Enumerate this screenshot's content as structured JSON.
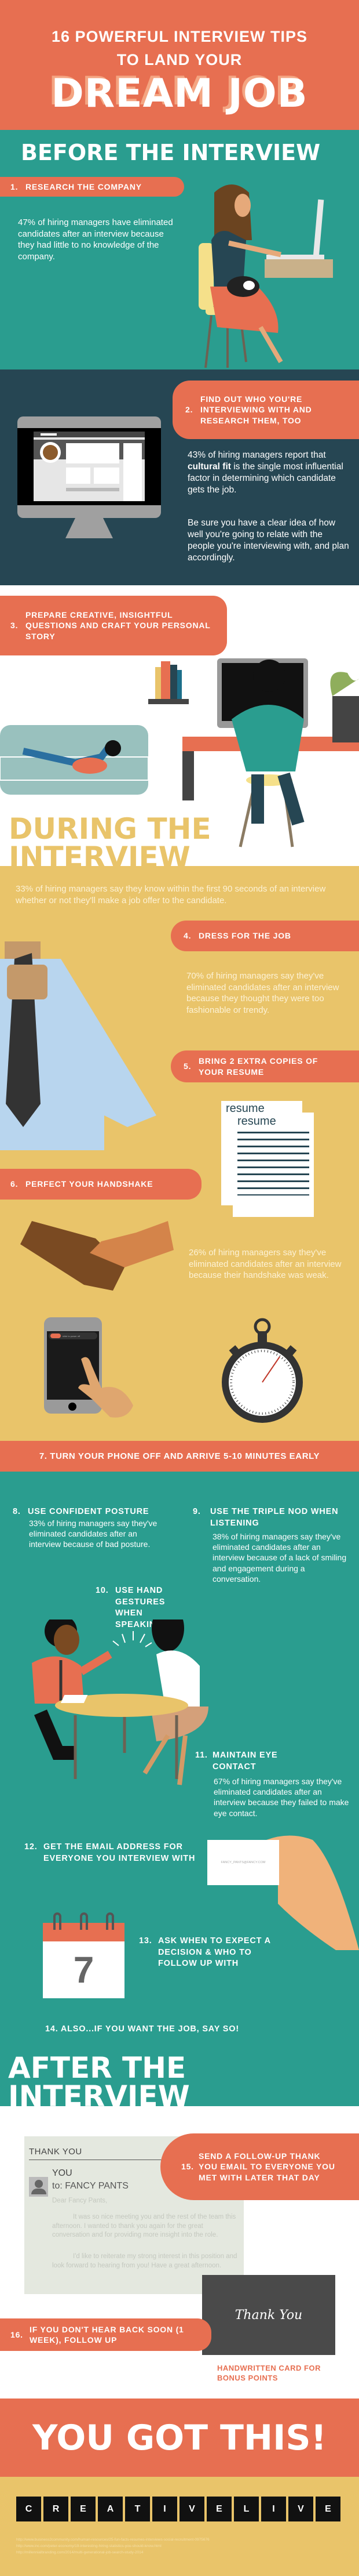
{
  "colors": {
    "coral": "#e76f51",
    "teal": "#2a9d8f",
    "navy": "#264653",
    "gold": "#e9c46a"
  },
  "header": {
    "line1": "16 POWERFUL INTERVIEW TIPS",
    "line2": "TO LAND YOUR",
    "big": "DREAM JOB"
  },
  "before": {
    "title": "BEFORE THE INTERVIEW",
    "tip1": {
      "num": "1.",
      "label": "RESEARCH THE COMPANY",
      "text": "47% of hiring managers have eliminated candidates after an interview because they had little to no knowledge of the company."
    },
    "tip2": {
      "num": "2.",
      "label": "FIND OUT WHO YOU'RE INTERVIEWING WITH AND RESEARCH THEM, TOO",
      "text_prefix": "43% of hiring managers report that ",
      "text_bold": "cultural fit",
      "text_suffix": " is the single most influential factor in determining which candidate gets the job.",
      "text2": "Be sure you have a clear idea of how well you're going to relate with the people you're interviewing with, and plan accordingly."
    },
    "tip3": {
      "num": "3.",
      "label": "PREPARE CREATIVE, INSIGHTFUL QUESTIONS AND CRAFT YOUR PERSONAL STORY"
    }
  },
  "during": {
    "title1": "DURING THE",
    "title2": "INTERVIEW",
    "intro": "33% of hiring managers say they know within the first 90 seconds of an interview whether or not they'll make a job offer to the candidate.",
    "tip4": {
      "num": "4.",
      "label": "DRESS FOR THE JOB",
      "text": "70% of hiring managers say they've eliminated candidates after an interview because they thought they were too fashionable or trendy."
    },
    "tip5": {
      "num": "5.",
      "label": "BRING 2 EXTRA COPIES OF YOUR RESUME",
      "resume_word": "resume"
    },
    "tip6": {
      "num": "6.",
      "label": "PERFECT YOUR HANDSHAKE",
      "text": "26% of hiring managers say they've eliminated candidates after an interview because their handshake was weak."
    },
    "phone_slider": "slide to power off",
    "tip7": {
      "label": "7. TURN YOUR PHONE OFF AND ARRIVE 5-10 MINUTES EARLY"
    },
    "tip8": {
      "num": "8.",
      "label": "USE CONFIDENT POSTURE",
      "text": "33% of hiring managers say they've eliminated candidates after an interview because of bad posture."
    },
    "tip9": {
      "num": "9.",
      "label": "USE THE TRIPLE NOD WHEN LISTENING",
      "text": "38% of hiring managers say they've eliminated candidates after an interview because of a lack of smiling and engagement during a conversation."
    },
    "tip10": {
      "num": "10.",
      "label": "USE HAND GESTURES WHEN SPEAKING"
    },
    "tip11": {
      "num": "11.",
      "label": "MAINTAIN EYE CONTACT",
      "text": "67% of hiring managers say they've eliminated candidates after an interview because they failed to make eye contact."
    },
    "tip12": {
      "num": "12.",
      "label": "GET THE EMAIL ADDRESS FOR EVERYONE YOU INTERVIEW WITH",
      "card_email": "FANCY_PANTS@FANCY.COM"
    },
    "tip13": {
      "num": "13.",
      "label": "ASK WHEN TO EXPECT A DECISION & WHO TO FOLLOW UP WITH",
      "calendar_day": "7"
    },
    "tip14": {
      "label": "14. ALSO...IF YOU WANT THE JOB, SAY SO!"
    }
  },
  "after": {
    "title1": "AFTER THE",
    "title2": "INTERVIEW",
    "email": {
      "subject": "THANK YOU",
      "from": "YOU",
      "to": "to: FANCY PANTS",
      "greeting": "Dear Fancy Pants,",
      "p1": "It was so nice meeting you and the rest of the team this afternoon. I wanted to thank you again for the great conversation and for providing more insight into the role.",
      "p2": "I'd like to reiterate my strong interest in this position and look forward to hearing from you! Have a great afternoon."
    },
    "tip15": {
      "num": "15.",
      "label": "SEND A FOLLOW-UP THANK YOU EMAIL TO EVERYONE YOU MET WITH LATER THAT DAY"
    },
    "card_text": "Thank You",
    "tip16": {
      "num": "16.",
      "label": "IF YOU DON'T HEAR BACK SOON (1 WEEK), FOLLOW UP"
    },
    "bonus": "HANDWRITTEN CARD FOR BONUS POINTS"
  },
  "closing": "YOU GOT THIS!",
  "logo": [
    "C",
    "R",
    "E",
    "A",
    "T",
    "I",
    "V",
    "E",
    "L",
    "I",
    "V",
    "E"
  ],
  "sources": [
    "http://www.business2community.com/human-resources/25-fun-facts-resumes-interviews-social-recruitment-0975676",
    "http://www.inc.com/peter-economy/19-interesting-hiring-statistics-you-should-know.html",
    "http://millennialbranding.com/2014/multi-generational-job-search-study-2014"
  ]
}
